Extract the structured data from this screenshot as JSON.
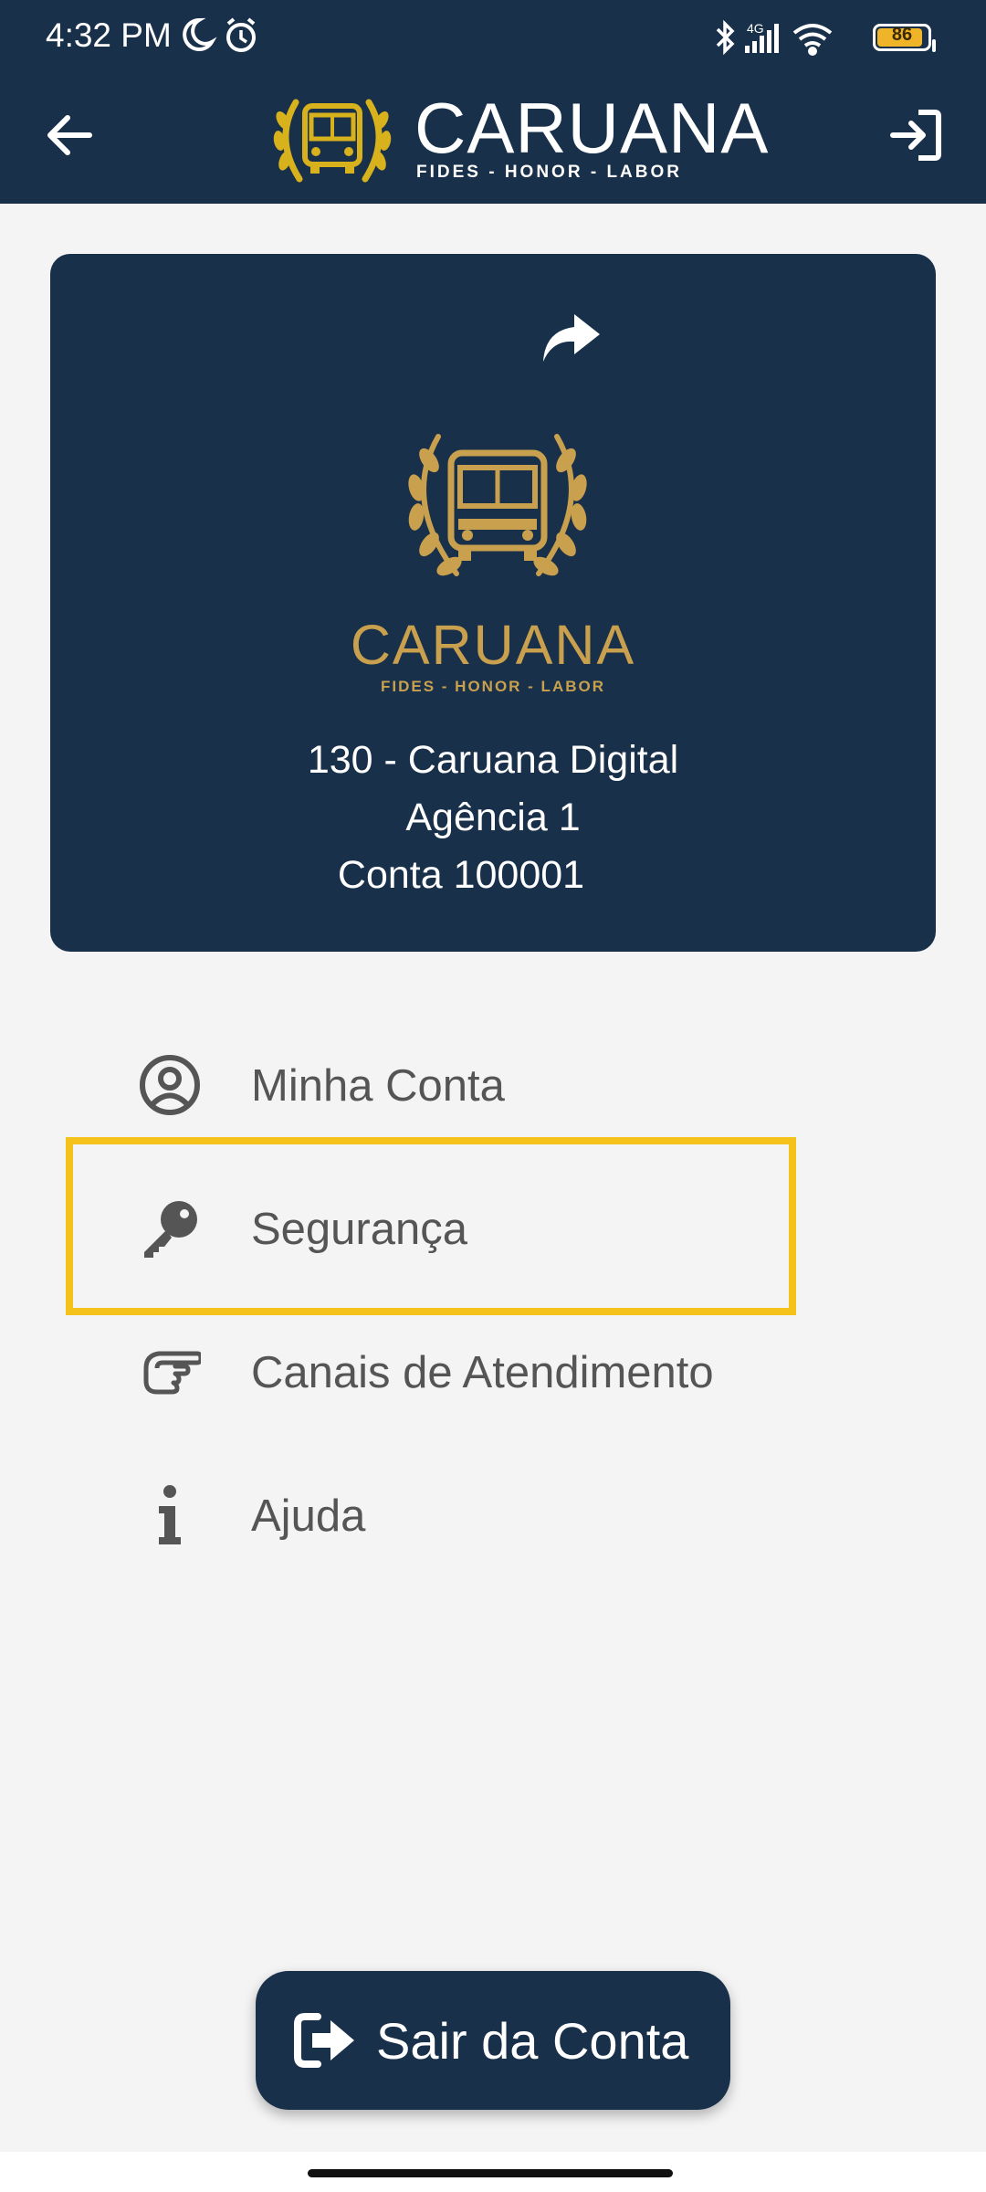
{
  "status_bar": {
    "time": "4:32 PM",
    "network": "4G",
    "battery_level": "86",
    "icons": [
      "moon-icon",
      "alarm-icon",
      "bluetooth-icon",
      "signal-icon",
      "wifi-icon",
      "battery-icon"
    ]
  },
  "app_bar": {
    "brand": "CARUANA",
    "motto": "FIDES - HONOR - LABOR",
    "back_icon": "arrow-left-icon",
    "logout_icon": "exit-icon"
  },
  "account_card": {
    "brand": "CARUANA",
    "motto": "FIDES - HONOR - LABOR",
    "bank_line": "130 - Caruana Digital",
    "agency_line": "Agência 1",
    "account_line": "Conta 100001",
    "share_icon": "share-arrow-icon"
  },
  "menu": {
    "items": [
      {
        "label": "Minha Conta",
        "icon": "user-circle-icon"
      },
      {
        "label": "Segurança",
        "icon": "key-icon"
      },
      {
        "label": "Canais de Atendimento",
        "icon": "hand-point-icon"
      },
      {
        "label": "Ajuda",
        "icon": "info-icon"
      }
    ]
  },
  "logout_button": {
    "label": "Sair da Conta",
    "icon": "sign-out-icon"
  },
  "colors": {
    "primary": "#19304a",
    "gold": "#c9a04e",
    "highlight": "#f5c21b",
    "background": "#f4f4f4",
    "menu_text": "#555555"
  }
}
